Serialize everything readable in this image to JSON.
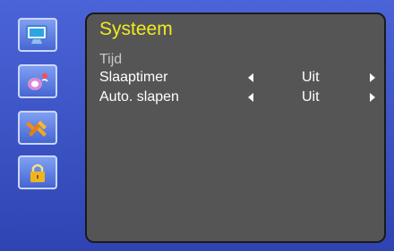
{
  "sidebar": {
    "items": [
      {
        "name": "picture",
        "icon": "monitor-icon"
      },
      {
        "name": "sound",
        "icon": "speaker-icon"
      },
      {
        "name": "setup",
        "icon": "tools-icon"
      },
      {
        "name": "lock",
        "icon": "lock-icon"
      }
    ]
  },
  "panel": {
    "title": "Systeem",
    "rows": [
      {
        "label": "Tijd",
        "value": ""
      },
      {
        "label": "Slaaptimer",
        "value": "Uit"
      },
      {
        "label": "Auto. slapen",
        "value": "Uit"
      }
    ]
  },
  "colors": {
    "background": "#3b50c0",
    "panel": "#555555",
    "title": "#f2ea20"
  }
}
